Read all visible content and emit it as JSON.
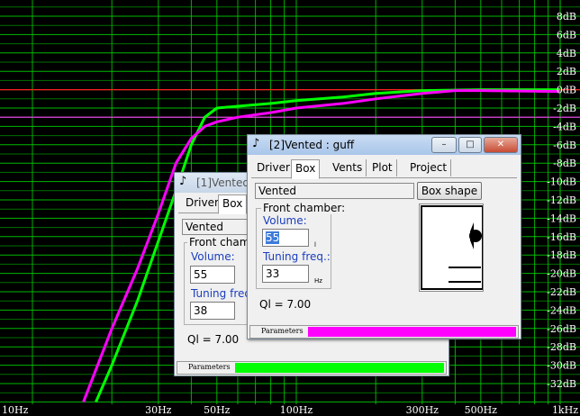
{
  "chart_data": {
    "type": "line",
    "x_axis": {
      "scale": "log",
      "range_hz": [
        10,
        1000
      ],
      "tick_labels": [
        {
          "hz": 10,
          "label": "10Hz"
        },
        {
          "hz": 30,
          "label": "30Hz"
        },
        {
          "hz": 50,
          "label": "50Hz"
        },
        {
          "hz": 100,
          "label": "100Hz"
        },
        {
          "hz": 300,
          "label": "300Hz"
        },
        {
          "hz": 500,
          "label": "500Hz"
        },
        {
          "hz": 1000,
          "label": "1kHz"
        }
      ]
    },
    "y_axis": {
      "range_db": [
        -34,
        9
      ],
      "tick_labels": [
        "8dB",
        "6dB",
        "4dB",
        "2dB",
        "0dB",
        "-2dB",
        "-4dB",
        "-6dB",
        "-8dB",
        "-10dB",
        "-12dB",
        "-14dB",
        "-16dB",
        "-18dB",
        "-20dB",
        "-22dB",
        "-24dB",
        "-26dB",
        "-28dB",
        "-30dB",
        "-32dB"
      ]
    },
    "reference_lines_db": [
      {
        "db": 0,
        "color": "#ff2020"
      },
      {
        "db": -3,
        "color": "#ff40ff"
      }
    ],
    "grid": true,
    "series": [
      {
        "color": "#00ff00",
        "points": [
          [
            17.4,
            -34
          ],
          [
            20,
            -30
          ],
          [
            25,
            -23
          ],
          [
            30,
            -16.5
          ],
          [
            35,
            -11
          ],
          [
            40,
            -6
          ],
          [
            45,
            -3
          ],
          [
            50,
            -2
          ],
          [
            60,
            -1.8
          ],
          [
            80,
            -1.5
          ],
          [
            100,
            -1.2
          ],
          [
            150,
            -0.8
          ],
          [
            200,
            -0.4
          ],
          [
            300,
            -0.1
          ],
          [
            500,
            0
          ],
          [
            1000,
            0
          ]
        ]
      },
      {
        "color": "#ff00ff",
        "points": [
          [
            15.6,
            -34
          ],
          [
            20,
            -26
          ],
          [
            25,
            -19.5
          ],
          [
            30,
            -13.5
          ],
          [
            35,
            -8
          ],
          [
            40,
            -5.3
          ],
          [
            45,
            -4
          ],
          [
            50,
            -3.5
          ],
          [
            60,
            -3
          ],
          [
            80,
            -2.5
          ],
          [
            100,
            -2
          ],
          [
            150,
            -1.5
          ],
          [
            200,
            -1
          ],
          [
            300,
            -0.4
          ],
          [
            400,
            -0.1
          ],
          [
            500,
            -0.1
          ],
          [
            1000,
            -0.2
          ]
        ]
      }
    ]
  },
  "window1": {
    "title": "[1]Vented : ",
    "tabs": [
      "Driver",
      "Box"
    ],
    "enclosure_type": "Vented",
    "front_chamber_label": "Front chamber:",
    "volume_label": "Volume:",
    "volume_value": "55",
    "tuning_label": "Tuning freq.:",
    "tuning_value": "38",
    "qi": "Ql = 7.00",
    "status_label": "Parameters",
    "status_color": "#00ff00"
  },
  "window2": {
    "title": "[2]Vented : guff",
    "tabs": [
      "Driver",
      "Box",
      "Vents",
      "Plot",
      "Project"
    ],
    "enclosure_type": "Vented",
    "box_shape_button": "Box shape",
    "front_chamber_label": "Front chamber:",
    "volume_label": "Volume:",
    "volume_value": "55",
    "volume_unit": "l",
    "tuning_label": "Tuning freq.:",
    "tuning_value": "33",
    "tuning_unit": "Hz",
    "qi": "Ql = 7.00",
    "status_label": "Parameters",
    "status_color": "#ff00ff",
    "minimize": "–",
    "maximize": "□",
    "close": "✕"
  }
}
